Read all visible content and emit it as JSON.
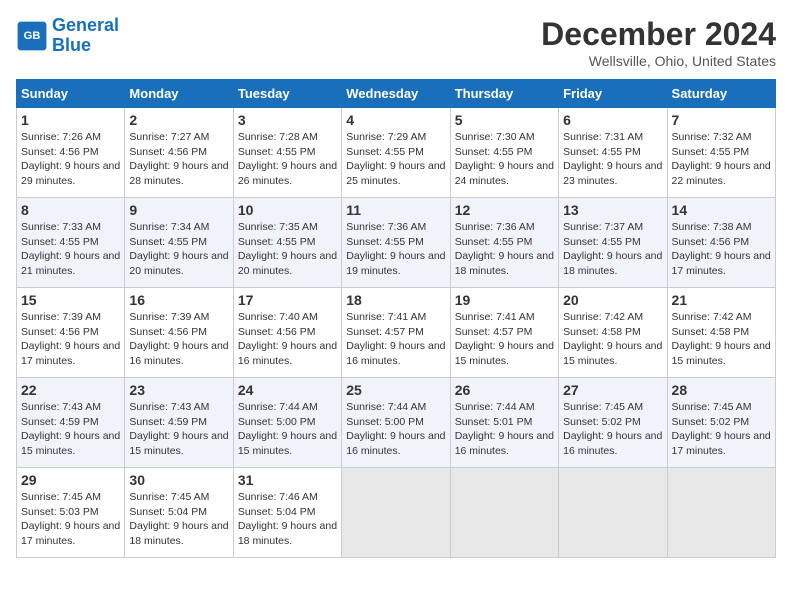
{
  "logo": {
    "line1": "General",
    "line2": "Blue"
  },
  "title": "December 2024",
  "subtitle": "Wellsville, Ohio, United States",
  "days_header": [
    "Sunday",
    "Monday",
    "Tuesday",
    "Wednesday",
    "Thursday",
    "Friday",
    "Saturday"
  ],
  "weeks": [
    [
      {
        "day": "1",
        "sunrise": "7:26 AM",
        "sunset": "4:56 PM",
        "daylight": "9 hours and 29 minutes."
      },
      {
        "day": "2",
        "sunrise": "7:27 AM",
        "sunset": "4:56 PM",
        "daylight": "9 hours and 28 minutes."
      },
      {
        "day": "3",
        "sunrise": "7:28 AM",
        "sunset": "4:55 PM",
        "daylight": "9 hours and 26 minutes."
      },
      {
        "day": "4",
        "sunrise": "7:29 AM",
        "sunset": "4:55 PM",
        "daylight": "9 hours and 25 minutes."
      },
      {
        "day": "5",
        "sunrise": "7:30 AM",
        "sunset": "4:55 PM",
        "daylight": "9 hours and 24 minutes."
      },
      {
        "day": "6",
        "sunrise": "7:31 AM",
        "sunset": "4:55 PM",
        "daylight": "9 hours and 23 minutes."
      },
      {
        "day": "7",
        "sunrise": "7:32 AM",
        "sunset": "4:55 PM",
        "daylight": "9 hours and 22 minutes."
      }
    ],
    [
      {
        "day": "8",
        "sunrise": "7:33 AM",
        "sunset": "4:55 PM",
        "daylight": "9 hours and 21 minutes."
      },
      {
        "day": "9",
        "sunrise": "7:34 AM",
        "sunset": "4:55 PM",
        "daylight": "9 hours and 20 minutes."
      },
      {
        "day": "10",
        "sunrise": "7:35 AM",
        "sunset": "4:55 PM",
        "daylight": "9 hours and 20 minutes."
      },
      {
        "day": "11",
        "sunrise": "7:36 AM",
        "sunset": "4:55 PM",
        "daylight": "9 hours and 19 minutes."
      },
      {
        "day": "12",
        "sunrise": "7:36 AM",
        "sunset": "4:55 PM",
        "daylight": "9 hours and 18 minutes."
      },
      {
        "day": "13",
        "sunrise": "7:37 AM",
        "sunset": "4:55 PM",
        "daylight": "9 hours and 18 minutes."
      },
      {
        "day": "14",
        "sunrise": "7:38 AM",
        "sunset": "4:56 PM",
        "daylight": "9 hours and 17 minutes."
      }
    ],
    [
      {
        "day": "15",
        "sunrise": "7:39 AM",
        "sunset": "4:56 PM",
        "daylight": "9 hours and 17 minutes."
      },
      {
        "day": "16",
        "sunrise": "7:39 AM",
        "sunset": "4:56 PM",
        "daylight": "9 hours and 16 minutes."
      },
      {
        "day": "17",
        "sunrise": "7:40 AM",
        "sunset": "4:56 PM",
        "daylight": "9 hours and 16 minutes."
      },
      {
        "day": "18",
        "sunrise": "7:41 AM",
        "sunset": "4:57 PM",
        "daylight": "9 hours and 16 minutes."
      },
      {
        "day": "19",
        "sunrise": "7:41 AM",
        "sunset": "4:57 PM",
        "daylight": "9 hours and 15 minutes."
      },
      {
        "day": "20",
        "sunrise": "7:42 AM",
        "sunset": "4:58 PM",
        "daylight": "9 hours and 15 minutes."
      },
      {
        "day": "21",
        "sunrise": "7:42 AM",
        "sunset": "4:58 PM",
        "daylight": "9 hours and 15 minutes."
      }
    ],
    [
      {
        "day": "22",
        "sunrise": "7:43 AM",
        "sunset": "4:59 PM",
        "daylight": "9 hours and 15 minutes."
      },
      {
        "day": "23",
        "sunrise": "7:43 AM",
        "sunset": "4:59 PM",
        "daylight": "9 hours and 15 minutes."
      },
      {
        "day": "24",
        "sunrise": "7:44 AM",
        "sunset": "5:00 PM",
        "daylight": "9 hours and 15 minutes."
      },
      {
        "day": "25",
        "sunrise": "7:44 AM",
        "sunset": "5:00 PM",
        "daylight": "9 hours and 16 minutes."
      },
      {
        "day": "26",
        "sunrise": "7:44 AM",
        "sunset": "5:01 PM",
        "daylight": "9 hours and 16 minutes."
      },
      {
        "day": "27",
        "sunrise": "7:45 AM",
        "sunset": "5:02 PM",
        "daylight": "9 hours and 16 minutes."
      },
      {
        "day": "28",
        "sunrise": "7:45 AM",
        "sunset": "5:02 PM",
        "daylight": "9 hours and 17 minutes."
      }
    ],
    [
      {
        "day": "29",
        "sunrise": "7:45 AM",
        "sunset": "5:03 PM",
        "daylight": "9 hours and 17 minutes."
      },
      {
        "day": "30",
        "sunrise": "7:45 AM",
        "sunset": "5:04 PM",
        "daylight": "9 hours and 18 minutes."
      },
      {
        "day": "31",
        "sunrise": "7:46 AM",
        "sunset": "5:04 PM",
        "daylight": "9 hours and 18 minutes."
      },
      null,
      null,
      null,
      null
    ]
  ]
}
